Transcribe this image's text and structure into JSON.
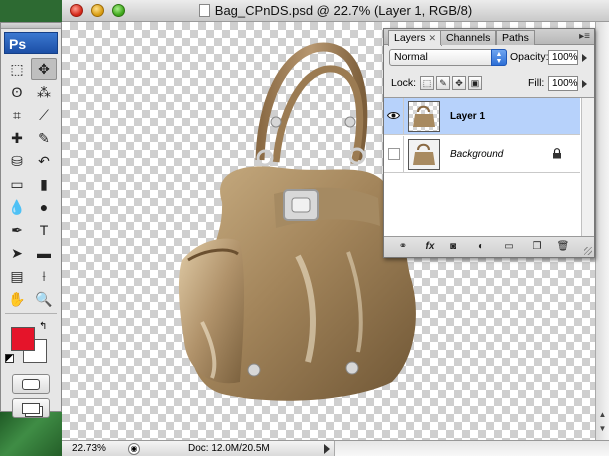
{
  "window": {
    "title": "Bag_CPnDS.psd @ 22.7% (Layer 1, RGB/8)"
  },
  "tools": {
    "logo": "Ps",
    "foreground_color": "#e5142a",
    "background_color": "#ffffff",
    "items": [
      {
        "name": "marquee",
        "glyph": "⬚"
      },
      {
        "name": "move",
        "glyph": "✥"
      },
      {
        "name": "lasso",
        "glyph": "ʘ"
      },
      {
        "name": "magic-wand",
        "glyph": "⁂"
      },
      {
        "name": "crop",
        "glyph": "⌗"
      },
      {
        "name": "slice",
        "glyph": "⟋"
      },
      {
        "name": "healing-brush",
        "glyph": "✚"
      },
      {
        "name": "brush",
        "glyph": "✎"
      },
      {
        "name": "clone-stamp",
        "glyph": "⛁"
      },
      {
        "name": "history-brush",
        "glyph": "↶"
      },
      {
        "name": "eraser",
        "glyph": "▭"
      },
      {
        "name": "gradient",
        "glyph": "▮"
      },
      {
        "name": "blur",
        "glyph": "💧"
      },
      {
        "name": "dodge",
        "glyph": "●"
      },
      {
        "name": "pen",
        "glyph": "✒"
      },
      {
        "name": "type",
        "glyph": "T"
      },
      {
        "name": "path-selection",
        "glyph": "➤"
      },
      {
        "name": "shape",
        "glyph": "▬"
      },
      {
        "name": "notes",
        "glyph": "▤"
      },
      {
        "name": "eyedropper",
        "glyph": "⟊"
      },
      {
        "name": "hand",
        "glyph": "✋"
      },
      {
        "name": "zoom",
        "glyph": "🔍"
      }
    ]
  },
  "layers_panel": {
    "tabs": [
      {
        "label": "Layers",
        "active": true
      },
      {
        "label": "Channels",
        "active": false
      },
      {
        "label": "Paths",
        "active": false
      }
    ],
    "blend_mode": "Normal",
    "opacity_label": "Opacity:",
    "opacity_value": "100%",
    "lock_label": "Lock:",
    "fill_label": "Fill:",
    "fill_value": "100%",
    "layers": [
      {
        "name": "Layer 1",
        "visible": true,
        "selected": true,
        "locked": false
      },
      {
        "name": "Background",
        "visible": false,
        "selected": false,
        "locked": true
      }
    ]
  },
  "status": {
    "zoom": "22.73%",
    "doc_size": "Doc: 12.0M/20.5M"
  }
}
